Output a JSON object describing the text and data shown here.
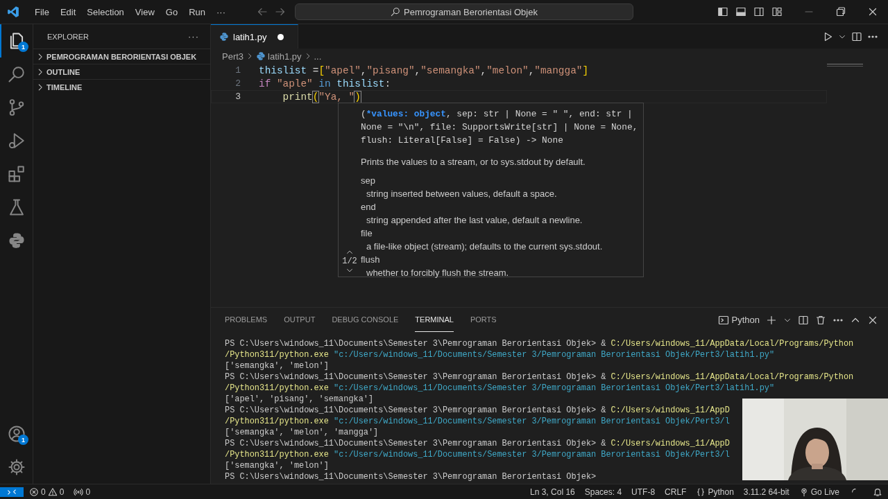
{
  "title_bar": {
    "menu": [
      "File",
      "Edit",
      "Selection",
      "View",
      "Go",
      "Run",
      "···"
    ],
    "command_center": "Pemrograman Berorientasi Objek"
  },
  "activity_bar": {
    "items": [
      {
        "kind": "explorer",
        "selected": true,
        "badge": "1"
      },
      {
        "kind": "search",
        "selected": false
      },
      {
        "kind": "source-control",
        "selected": false
      },
      {
        "kind": "run-debug",
        "selected": false
      },
      {
        "kind": "extensions",
        "selected": false
      },
      {
        "kind": "testing",
        "selected": false
      },
      {
        "kind": "python",
        "selected": false
      }
    ],
    "bottom": [
      {
        "kind": "account",
        "badge": "1"
      },
      {
        "kind": "settings"
      }
    ]
  },
  "sidebar": {
    "title": "EXPLORER",
    "more": "···",
    "sections": [
      {
        "label": "PEMROGRAMAN BERORIENTASI OBJEK",
        "expanded": false
      },
      {
        "label": "OUTLINE",
        "expanded": false
      },
      {
        "label": "TIMELINE",
        "expanded": false
      }
    ]
  },
  "tabs": [
    {
      "label": "latih1.py",
      "selected": true,
      "dirty": true
    }
  ],
  "breadcrumbs": [
    "Pert3",
    "latih1.py",
    "..."
  ],
  "editor": {
    "lines": [
      {
        "number": "1",
        "current": false,
        "tokens": [
          {
            "text": "thislist",
            "kind": "var"
          },
          {
            "text": " =",
            "kind": "plain"
          },
          {
            "text": "[",
            "kind": "bracket"
          },
          {
            "text": "\"apel\"",
            "kind": "string"
          },
          {
            "text": ",",
            "kind": "plain"
          },
          {
            "text": "\"pisang\"",
            "kind": "string"
          },
          {
            "text": ",",
            "kind": "plain"
          },
          {
            "text": "\"semangka\"",
            "kind": "string"
          },
          {
            "text": ",",
            "kind": "plain"
          },
          {
            "text": "\"melon\"",
            "kind": "string"
          },
          {
            "text": ",",
            "kind": "plain"
          },
          {
            "text": "\"mangga\"",
            "kind": "string"
          },
          {
            "text": "]",
            "kind": "bracket"
          }
        ]
      },
      {
        "number": "2",
        "current": false,
        "tokens": [
          {
            "text": "if",
            "kind": "control"
          },
          {
            "text": " \"aple\"",
            "kind": "string"
          },
          {
            "text": " in",
            "kind": "keyword"
          },
          {
            "text": " thislist",
            "kind": "var"
          },
          {
            "text": ":",
            "kind": "plain"
          }
        ]
      },
      {
        "number": "3",
        "current": true,
        "tokens": [
          {
            "text": "    print",
            "kind": "function"
          },
          {
            "text": "(",
            "kind": "bracket-match"
          },
          {
            "text": "\"Ya, \"",
            "kind": "string"
          },
          {
            "text": ")",
            "kind": "bracket-match"
          }
        ]
      }
    ]
  },
  "signature_help": {
    "counter": "1/2",
    "signature": [
      {
        "text": "(",
        "kind": "plain"
      },
      {
        "text": "*values: object",
        "kind": "active"
      },
      {
        "text": ", sep: str | None = \" \", end: str | None = \"\\n\", file: SupportsWrite[str] | None = None, flush: Literal[False] = False) -> None",
        "kind": "plain"
      }
    ],
    "description": "Prints the values to a stream, or to sys.stdout by default.",
    "params": [
      {
        "name": "sep",
        "doc": "string inserted between values, default a space."
      },
      {
        "name": "end",
        "doc": "string appended after the last value, default a newline."
      },
      {
        "name": "file",
        "doc": "a file-like object (stream); defaults to the current sys.stdout."
      },
      {
        "name": "flush",
        "doc": "whether to forcibly flush the stream."
      }
    ]
  },
  "panel": {
    "tabs": [
      {
        "label": "PROBLEMS",
        "selected": false
      },
      {
        "label": "OUTPUT",
        "selected": false
      },
      {
        "label": "DEBUG CONSOLE",
        "selected": false
      },
      {
        "label": "TERMINAL",
        "selected": true
      },
      {
        "label": "PORTS",
        "selected": false
      }
    ],
    "terminal_name": "Python",
    "terminal": [
      [
        {
          "text": "PS C:\\Users\\windows_11\\Documents\\Semester 3\\Pemrograman Berorientasi Objek> & ",
          "kind": "plain"
        },
        {
          "text": "C:/Users/windows_11/AppData/Local/Programs/Python",
          "kind": "exe"
        }
      ],
      [
        {
          "text": "/Python311/python.exe",
          "kind": "exe"
        },
        {
          "text": " \"c:/Users/windows_11/Documents/Semester 3/Pemrograman Berorientasi Objek/Pert3/latih1.py\"",
          "kind": "arg"
        }
      ],
      [
        {
          "text": "['semangka', 'melon']",
          "kind": "plain"
        }
      ],
      [
        {
          "text": "PS C:\\Users\\windows_11\\Documents\\Semester 3\\Pemrograman Berorientasi Objek> & ",
          "kind": "plain"
        },
        {
          "text": "C:/Users/windows_11/AppData/Local/Programs/Python",
          "kind": "exe"
        }
      ],
      [
        {
          "text": "/Python311/python.exe",
          "kind": "exe"
        },
        {
          "text": " \"c:/Users/windows_11/Documents/Semester 3/Pemrograman Berorientasi Objek/Pert3/latih1.py\"",
          "kind": "arg"
        }
      ],
      [
        {
          "text": "['apel', 'pisang', 'semangka']",
          "kind": "plain"
        }
      ],
      [
        {
          "text": "PS C:\\Users\\windows_11\\Documents\\Semester 3\\Pemrograman Berorientasi Objek> & ",
          "kind": "plain"
        },
        {
          "text": "C:/Users/windows_11/AppD",
          "kind": "exe"
        }
      ],
      [
        {
          "text": "/Python311/python.exe",
          "kind": "exe"
        },
        {
          "text": " \"c:/Users/windows_11/Documents/Semester 3/Pemrograman Berorientasi Objek/Pert3/l",
          "kind": "arg"
        }
      ],
      [
        {
          "text": "['semangka', 'melon', 'mangga']",
          "kind": "plain"
        }
      ],
      [
        {
          "text": "PS C:\\Users\\windows_11\\Documents\\Semester 3\\Pemrograman Berorientasi Objek> & ",
          "kind": "plain"
        },
        {
          "text": "C:/Users/windows_11/AppD",
          "kind": "exe"
        }
      ],
      [
        {
          "text": "/Python311/python.exe",
          "kind": "exe"
        },
        {
          "text": " \"c:/Users/windows_11/Documents/Semester 3/Pemrograman Berorientasi Objek/Pert3/l",
          "kind": "arg"
        }
      ],
      [
        {
          "text": "['semangka', 'melon']",
          "kind": "plain"
        }
      ],
      [
        {
          "text": "PS C:\\Users\\windows_11\\Documents\\Semester 3\\Pemrograman Berorientasi Objek>",
          "kind": "plain"
        }
      ]
    ]
  },
  "webcam": {
    "kind": "picture"
  },
  "status_bar": {
    "left": [
      {
        "kind": "remote"
      },
      {
        "kind": "problems",
        "errors": "0",
        "warnings": "0"
      },
      {
        "kind": "ports",
        "text": "0"
      }
    ],
    "right": [
      {
        "kind": "text",
        "text": "Ln 3, Col 16"
      },
      {
        "kind": "text",
        "text": "Spaces: 4"
      },
      {
        "kind": "text",
        "text": "UTF-8"
      },
      {
        "kind": "text",
        "text": "CRLF"
      },
      {
        "kind": "language",
        "text": "Python"
      },
      {
        "kind": "text",
        "text": "3.11.2 64-bit"
      },
      {
        "kind": "golive",
        "text": "Go Live"
      },
      {
        "kind": "spinner"
      },
      {
        "kind": "bell"
      }
    ]
  }
}
